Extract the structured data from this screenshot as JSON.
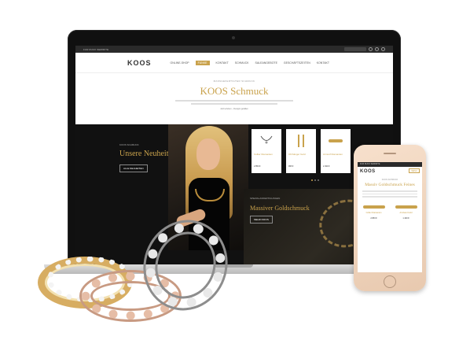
{
  "laptop": {
    "topbar": {
      "left_text": "FUR RUCK SEMIR/TE"
    },
    "nav": {
      "logo": "KOOS",
      "items": [
        "ONLINE-SHOP",
        "FUNKE",
        "KONTAKT",
        "SCHMUCK",
        "SALEANGEBOTE",
        "GESCHÄFTSZEITEN",
        "KONTAKT"
      ],
      "active_index": 1
    },
    "hero": {
      "eyebrow": "MASSGEFERTIGTER SCHMUCK",
      "title": "KOOS Schmuck",
      "tiny": "Jetzt erleben – Designs gefallen"
    },
    "news": {
      "eyebrow": "KOOS SCHMUCK",
      "heading": "Unsere Neuheiten",
      "button": "ALLE NEUHEITEN"
    },
    "products": [
      {
        "name": "Collier Diamanten",
        "price": "2.850 €"
      },
      {
        "name": "Ohrhänger Gold",
        "price": "995 €"
      },
      {
        "name": "Armreif Diamanten",
        "price": "2.490 €"
      }
    ],
    "gold": {
      "eyebrow": "SPEZIALANFERTIGUNGEN",
      "heading": "Massiver Goldschmuck",
      "button": "MEHR INFOS"
    }
  },
  "phone": {
    "top": "FUR RUCK SEMIR/TE",
    "logo": "KOOS",
    "menu": "MENU",
    "eyebrow": "KOOS SCHMUCK",
    "title": "Massiv Goldschmuck Feines",
    "products": [
      {
        "name": "Collier Diamanten",
        "price": "2.850 €"
      },
      {
        "name": "Armband Gold",
        "price": "1.190 €"
      }
    ]
  },
  "colors": {
    "accent_gold": "#c9a24c",
    "dark_bg": "#111111"
  }
}
